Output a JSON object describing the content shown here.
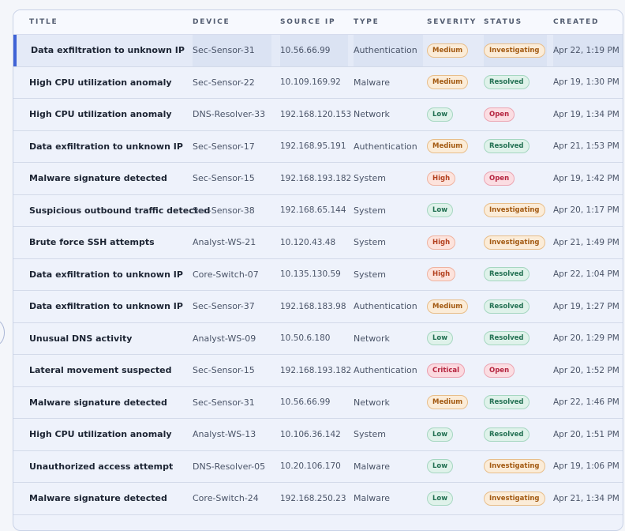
{
  "table": {
    "headers": {
      "title": "TITLE",
      "device": "DEVICE",
      "source_ip": "SOURCE IP",
      "type": "TYPE",
      "severity": "SEVERITY",
      "status": "STATUS",
      "created": "CREATED"
    },
    "selected_row": 0,
    "rows": [
      {
        "title": "Data exfiltration to unknown IP",
        "device": "Sec-Sensor-31",
        "source_ip": "10.56.66.99",
        "type": "Authentication",
        "severity": "Medium",
        "status": "Investigating",
        "created": "Apr 22, 1:19 PM"
      },
      {
        "title": "High CPU utilization anomaly",
        "device": "Sec-Sensor-22",
        "source_ip": "10.109.169.92",
        "type": "Malware",
        "severity": "Medium",
        "status": "Resolved",
        "created": "Apr 19, 1:30 PM"
      },
      {
        "title": "High CPU utilization anomaly",
        "device": "DNS-Resolver-33",
        "source_ip": "192.168.120.153",
        "type": "Network",
        "severity": "Low",
        "status": "Open",
        "created": "Apr 19, 1:34 PM"
      },
      {
        "title": "Data exfiltration to unknown IP",
        "device": "Sec-Sensor-17",
        "source_ip": "192.168.95.191",
        "type": "Authentication",
        "severity": "Medium",
        "status": "Resolved",
        "created": "Apr 21, 1:53 PM"
      },
      {
        "title": "Malware signature detected",
        "device": "Sec-Sensor-15",
        "source_ip": "192.168.193.182",
        "type": "System",
        "severity": "High",
        "status": "Open",
        "created": "Apr 19, 1:42 PM"
      },
      {
        "title": "Suspicious outbound traffic detected",
        "device": "Sec-Sensor-38",
        "source_ip": "192.168.65.144",
        "type": "System",
        "severity": "Low",
        "status": "Investigating",
        "created": "Apr 20, 1:17 PM"
      },
      {
        "title": "Brute force SSH attempts",
        "device": "Analyst-WS-21",
        "source_ip": "10.120.43.48",
        "type": "System",
        "severity": "High",
        "status": "Investigating",
        "created": "Apr 21, 1:49 PM"
      },
      {
        "title": "Data exfiltration to unknown IP",
        "device": "Core-Switch-07",
        "source_ip": "10.135.130.59",
        "type": "System",
        "severity": "High",
        "status": "Resolved",
        "created": "Apr 22, 1:04 PM"
      },
      {
        "title": "Data exfiltration to unknown IP",
        "device": "Sec-Sensor-37",
        "source_ip": "192.168.183.98",
        "type": "Authentication",
        "severity": "Medium",
        "status": "Resolved",
        "created": "Apr 19, 1:27 PM"
      },
      {
        "title": "Unusual DNS activity",
        "device": "Analyst-WS-09",
        "source_ip": "10.50.6.180",
        "type": "Network",
        "severity": "Low",
        "status": "Resolved",
        "created": "Apr 20, 1:29 PM"
      },
      {
        "title": "Lateral movement suspected",
        "device": "Sec-Sensor-15",
        "source_ip": "192.168.193.182",
        "type": "Authentication",
        "severity": "Critical",
        "status": "Open",
        "created": "Apr 20, 1:52 PM"
      },
      {
        "title": "Malware signature detected",
        "device": "Sec-Sensor-31",
        "source_ip": "10.56.66.99",
        "type": "Network",
        "severity": "Medium",
        "status": "Resolved",
        "created": "Apr 22, 1:46 PM"
      },
      {
        "title": "High CPU utilization anomaly",
        "device": "Analyst-WS-13",
        "source_ip": "10.106.36.142",
        "type": "System",
        "severity": "Low",
        "status": "Resolved",
        "created": "Apr 20, 1:51 PM"
      },
      {
        "title": "Unauthorized access attempt",
        "device": "DNS-Resolver-05",
        "source_ip": "10.20.106.170",
        "type": "Malware",
        "severity": "Low",
        "status": "Investigating",
        "created": "Apr 19, 1:06 PM"
      },
      {
        "title": "Malware signature detected",
        "device": "Core-Switch-24",
        "source_ip": "192.168.250.23",
        "type": "Malware",
        "severity": "Low",
        "status": "Investigating",
        "created": "Apr 21, 1:34 PM"
      }
    ]
  },
  "colors": {
    "accent": "#3f63d6",
    "severity_medium": "#a35a12",
    "severity_low": "#227052",
    "severity_high": "#b3411f",
    "severity_critical": "#b4233e",
    "status_investigating": "#a35a12",
    "status_resolved": "#227052",
    "status_open": "#b4233e"
  }
}
